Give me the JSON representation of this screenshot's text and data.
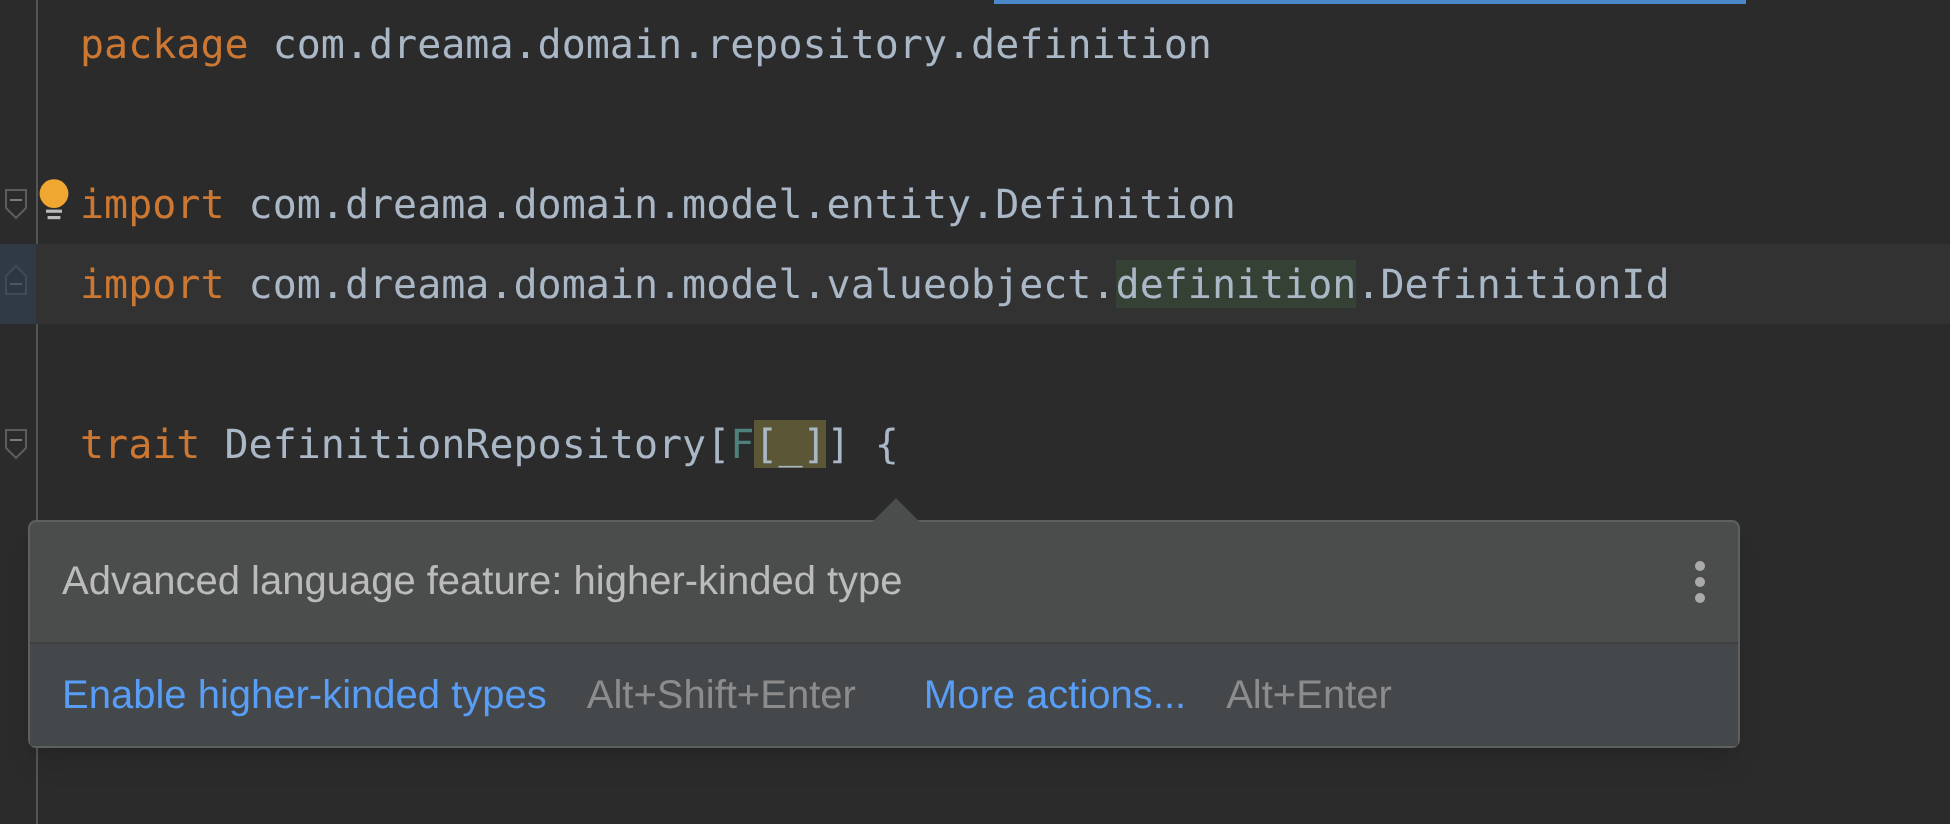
{
  "editor": {
    "lines": [
      {
        "fold_start": false,
        "fold_end": false,
        "current": false,
        "bulb": false,
        "tokens": [
          {
            "kind": "keyword",
            "text": "package"
          },
          {
            "kind": "text",
            "text": " com.dreama.domain.repository.definition"
          }
        ]
      },
      {
        "fold_start": false,
        "fold_end": false,
        "current": false,
        "bulb": false
      },
      {
        "fold_start": true,
        "fold_end": false,
        "current": false,
        "bulb": true,
        "tokens": [
          {
            "kind": "keyword",
            "text": "import"
          },
          {
            "kind": "text",
            "text": " com.dreama.domain.model.entity.Definition"
          }
        ]
      },
      {
        "fold_start": false,
        "fold_end": true,
        "current": true,
        "bulb": false,
        "tokens": [
          {
            "kind": "keyword",
            "text": "import"
          },
          {
            "kind": "text",
            "text": " com.dreama.domain.model.valueobject."
          },
          {
            "kind": "usage",
            "text": "definition"
          },
          {
            "kind": "text",
            "text": ".DefinitionId"
          }
        ]
      },
      {
        "fold_start": false,
        "fold_end": false,
        "current": false,
        "bulb": false
      },
      {
        "fold_start": true,
        "fold_end": false,
        "current": false,
        "bulb": false,
        "tokens": [
          {
            "kind": "keyword",
            "text": "trait"
          },
          {
            "kind": "text",
            "text": " DefinitionRepository["
          },
          {
            "kind": "param",
            "text": "F"
          },
          {
            "kind": "match",
            "text": "[_]"
          },
          {
            "kind": "text",
            "text": "] {"
          }
        ]
      }
    ]
  },
  "popup": {
    "message": "Advanced language feature: higher-kinded type",
    "actions": [
      {
        "label": "Enable higher-kinded types",
        "shortcut": "Alt+Shift+Enter"
      },
      {
        "label": "More actions...",
        "shortcut": "Alt+Enter"
      }
    ]
  }
}
